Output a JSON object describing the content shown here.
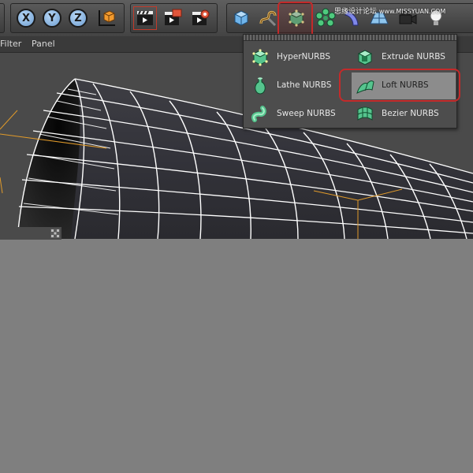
{
  "toolbar": {
    "axis_buttons": [
      {
        "label": "X"
      },
      {
        "label": "Y"
      },
      {
        "label": "Z"
      }
    ],
    "watermark": {
      "line1": "思缘设计论坛",
      "line2": "www.MISSYUAN.COM"
    }
  },
  "menubar": {
    "items": [
      {
        "label": "Filter"
      },
      {
        "label": "Panel"
      }
    ]
  },
  "dropdown": {
    "items": [
      {
        "label": "HyperNURBS",
        "icon": "hypernurbs-icon"
      },
      {
        "label": "Extrude NURBS",
        "icon": "extrude-nurbs-icon"
      },
      {
        "label": "Lathe NURBS",
        "icon": "lathe-nurbs-icon"
      },
      {
        "label": "Loft NURBS",
        "icon": "loft-nurbs-icon",
        "selected": true
      },
      {
        "label": "Sweep NURBS",
        "icon": "sweep-nurbs-icon"
      },
      {
        "label": "Bezier NURBS",
        "icon": "bezier-nurbs-icon"
      }
    ]
  },
  "colors": {
    "highlight": "#c42a2a",
    "accent_green": "#6fd4a4",
    "wireframe": "#ffffff",
    "axis_orange": "#e09a2a",
    "viewport_bg": "#4a4a4a",
    "background": "#7f7f7f"
  }
}
